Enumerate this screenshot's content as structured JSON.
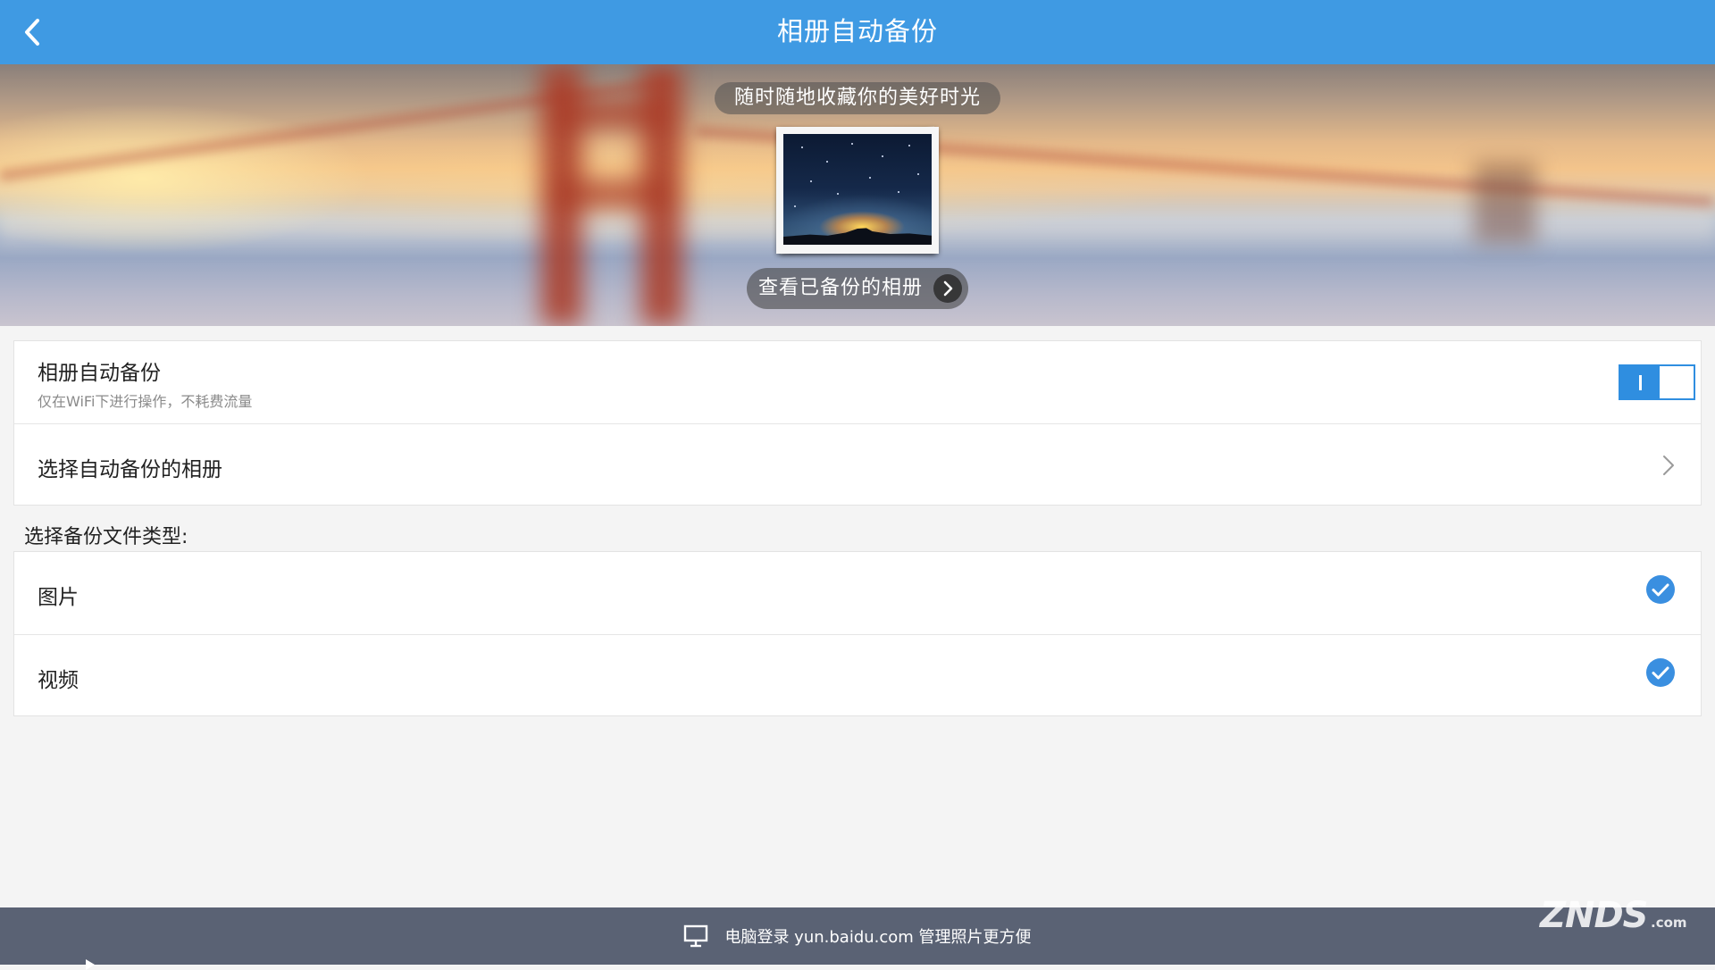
{
  "header": {
    "title": "相册自动备份",
    "back_icon": "chevron-left-icon",
    "background": "#3f9ae3"
  },
  "banner": {
    "slogan": "随时随地收藏你的美好时光",
    "view_button_label": "查看已备份的相册"
  },
  "settings": {
    "auto_backup": {
      "title": "相册自动备份",
      "subtitle": "仅在WiFi下进行操作，不耗费流量",
      "enabled": true
    },
    "select_album": {
      "title": "选择自动备份的相册"
    }
  },
  "file_types": {
    "section_label": "选择备份文件类型:",
    "items": [
      {
        "label": "图片",
        "checked": true
      },
      {
        "label": "视频",
        "checked": true
      }
    ]
  },
  "footer": {
    "text": "电脑登录 yun.baidu.com 管理照片更方便",
    "icon": "monitor-icon",
    "background": "#5a6274"
  },
  "watermark": {
    "text": "ZNDS",
    "suffix": ".com"
  },
  "colors": {
    "accent": "#2f8ee0",
    "check": "#3a8fe0"
  }
}
